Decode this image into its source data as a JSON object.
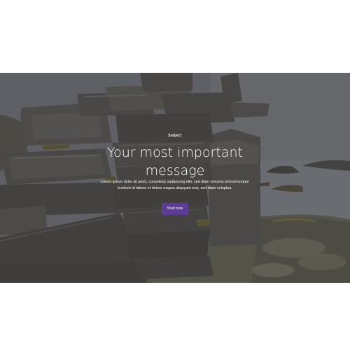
{
  "hero": {
    "eyebrow": "Subject",
    "headline_line1": "Your most important",
    "headline_line2": "message",
    "body_line1": "Lorem ipsum dolor sit amet, consetetur sadipscing elitr, sed diam nonumy eirmod tempor",
    "body_line2": "invidunt ut labore et dolore magna aliquyam erat, sed diam voluptua.",
    "cta_label": "Start now"
  },
  "colors": {
    "cta_background": "#5c3d94",
    "overlay": "rgba(30,30,34,0.42)",
    "text": "#ffffff"
  },
  "icons": []
}
